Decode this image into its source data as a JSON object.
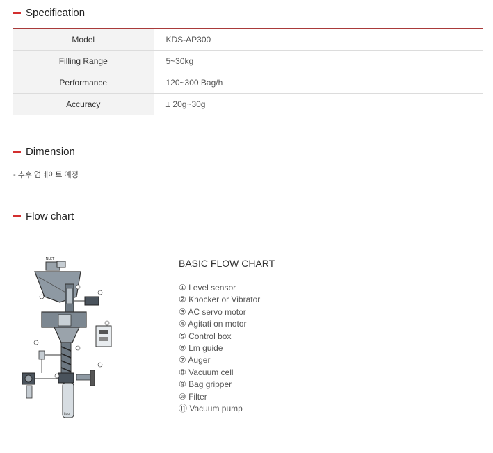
{
  "specification": {
    "title": "Specification",
    "rows": [
      {
        "label": "Model",
        "value": "KDS-AP300"
      },
      {
        "label": "Filling Range",
        "value": "5~30kg"
      },
      {
        "label": "Performance",
        "value": "120~300 Bag/h"
      },
      {
        "label": "Accuracy",
        "value": "± 20g~30g"
      }
    ]
  },
  "dimension": {
    "title": "Dimension",
    "note": "- 추후 업데이트 예정"
  },
  "flow_chart": {
    "title": "Flow chart",
    "heading": "BASIC FLOW CHART",
    "items": [
      "① Level sensor",
      "② Knocker or Vibrator",
      "③ AC servo motor",
      "④ Agitati on motor",
      "⑤ Control box",
      "⑥ Lm guide",
      "⑦ Auger",
      "⑧ Vacuum cell",
      "⑨ Bag gripper",
      "⑩ Filter",
      "⑪ Vacuum pump"
    ],
    "diagram_labels": {
      "inlet": "INLET",
      "bag": "Bag"
    }
  },
  "colors": {
    "accent": "#d32f2f",
    "table_header_bg": "#f3f3f3",
    "table_border": "#dcdcdc"
  }
}
